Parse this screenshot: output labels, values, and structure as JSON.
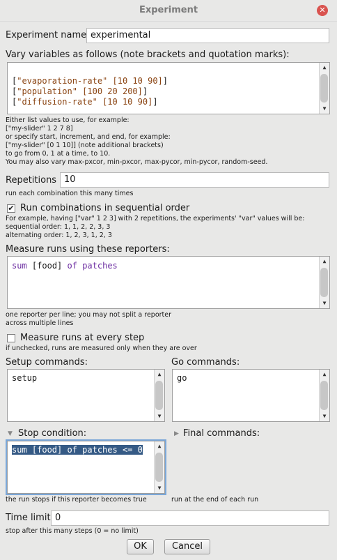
{
  "window": {
    "title": "Experiment"
  },
  "experiment_name": {
    "label": "Experiment name",
    "value": "experimental"
  },
  "vary": {
    "label": "Vary variables as follows (note brackets and quotation marks):",
    "lines": [
      {
        "name": "\"evaporation-rate\"",
        "values": "[10 10 90]"
      },
      {
        "name": "\"population\"",
        "values": "[100 20 200]"
      },
      {
        "name": "\"diffusion-rate\"",
        "values": "[10 10 90]"
      }
    ],
    "help": "Either list values to use, for example:\n[\"my-slider\" 1 2 7 8]\nor specify start, increment, and end, for example:\n[\"my-slider\" [0 1 10]] (note additional brackets)\nto go from 0, 1 at a time, to 10.\nYou may also vary max-pxcor, min-pxcor, max-pycor, min-pycor, random-seed."
  },
  "repetitions": {
    "label": "Repetitions",
    "value": "10",
    "help": "run each combination this many times"
  },
  "sequential": {
    "label": "Run combinations in sequential order",
    "checked": true,
    "help": "For example, having [\"var\" 1 2 3] with 2 repetitions, the experiments' \"var\" values will be:\nsequential order: 1, 1, 2, 2, 3, 3\nalternating order: 1, 2, 3, 1, 2, 3"
  },
  "reporters": {
    "label": "Measure runs using these reporters:",
    "kw1": "sum",
    "arg": "[food]",
    "kw2": "of patches",
    "help": "one reporter per line; you may not split a reporter\nacross multiple lines"
  },
  "every_step": {
    "label": "Measure runs at every step",
    "checked": false,
    "help": "if unchecked, runs are measured only when they are over"
  },
  "setup": {
    "label": "Setup commands:",
    "value": "setup"
  },
  "go": {
    "label": "Go commands:",
    "value": "go"
  },
  "stop": {
    "label": "Stop condition:",
    "value": "sum [food] of patches <= 0",
    "help": "the run stops if this reporter becomes true"
  },
  "final": {
    "label": "Final commands:",
    "help": "run at the end of each run"
  },
  "time_limit": {
    "label": "Time limit",
    "value": "0",
    "help": "stop after this many steps (0 = no limit)"
  },
  "buttons": {
    "ok": "OK",
    "cancel": "Cancel"
  },
  "icons": {
    "close": "close-icon",
    "check": "checkmark-icon",
    "scroll_up": "arrow-up-icon",
    "scroll_down": "arrow-down-icon",
    "expand": "triangle-icon"
  }
}
